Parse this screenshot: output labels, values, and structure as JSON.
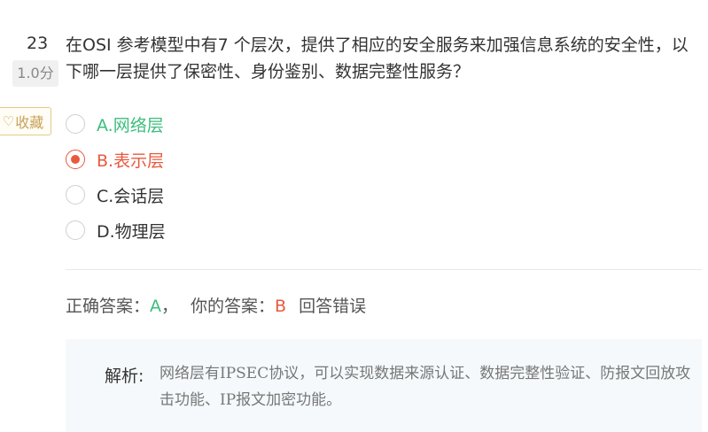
{
  "question": {
    "number": "23",
    "score": "1.0分",
    "stem": "在OSI 参考模型中有7 个层次，提供了相应的安全服务来加强信息系统的安全性，以下哪一层提供了保密性、身份鉴别、数据完整性服务？",
    "favorite_label": "收藏",
    "favorite_icon": "heart-outline-icon"
  },
  "options": [
    {
      "label": "A.网络层",
      "state": "correct"
    },
    {
      "label": "B.表示层",
      "state": "selected-wrong"
    },
    {
      "label": "C.会话层",
      "state": "none"
    },
    {
      "label": "D.物理层",
      "state": "none"
    }
  ],
  "result": {
    "correct_answer_label": "正确答案：",
    "correct_answer": "A",
    "separator": "，",
    "your_answer_label": "你的答案：",
    "your_answer": "B",
    "verdict": "回答错误"
  },
  "analysis": {
    "title": "解析:",
    "text": "网络层有IPSEC协议，可以实现数据来源认证、数据完整性验证、防报文回放攻击功能、IP报文加密功能。"
  },
  "colors": {
    "correct": "#3dbd7d",
    "wrong": "#e9593f",
    "favorite": "#c8a258",
    "analysis_bg": "#f5f9fc"
  }
}
